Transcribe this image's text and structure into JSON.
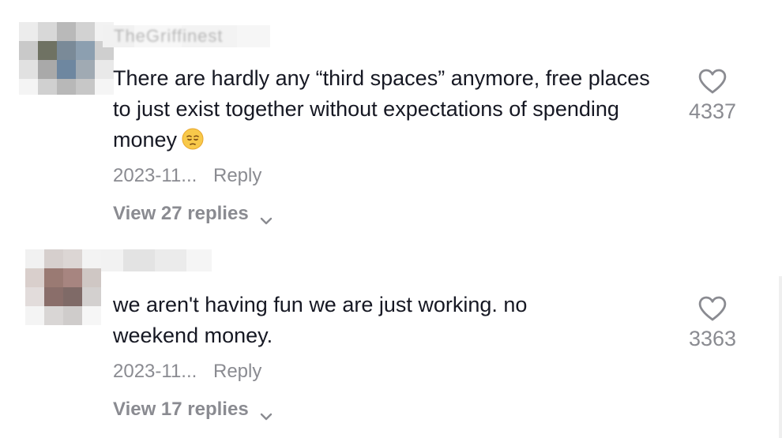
{
  "comments": [
    {
      "username": "TheGriffinest",
      "text": "There are hardly any “third spaces” anymore, free places to just exist together without expectations of spending money",
      "emoji_icon": "pensive-face-icon",
      "date": "2023-11...",
      "reply_label": "Reply",
      "view_replies": "View 27 replies",
      "likes": "4337"
    },
    {
      "username": "",
      "text": "we aren't having fun we are just working. no weekend money.",
      "date": "2023-11...",
      "reply_label": "Reply",
      "view_replies": "View 17 replies",
      "likes": "3363"
    }
  ],
  "colors": {
    "text_primary": "#161823",
    "text_secondary": "#8a8b91",
    "background": "#ffffff"
  }
}
